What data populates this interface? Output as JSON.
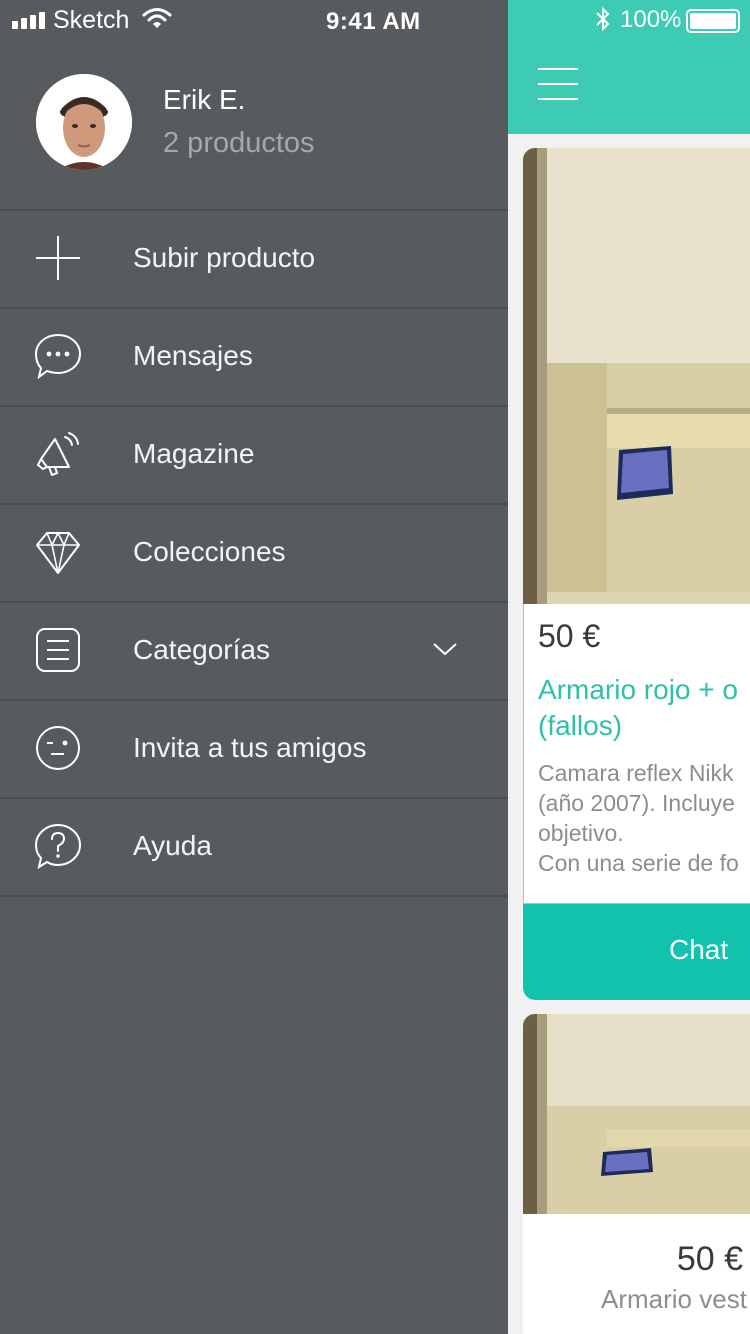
{
  "status_bar": {
    "carrier": "Sketch",
    "time": "9:41 AM",
    "battery_pct": "100%"
  },
  "profile": {
    "name": "Erik E.",
    "subtitle": "2 productos"
  },
  "menu": [
    {
      "label": "Subir producto",
      "icon": "plus-icon"
    },
    {
      "label": "Mensajes",
      "icon": "chat-bubble-icon"
    },
    {
      "label": "Magazine",
      "icon": "megaphone-icon"
    },
    {
      "label": "Colecciones",
      "icon": "diamond-icon"
    },
    {
      "label": "Categorías",
      "icon": "list-icon",
      "expandable": true
    },
    {
      "label": "Invita a tus amigos",
      "icon": "wink-face-icon"
    },
    {
      "label": "Ayuda",
      "icon": "help-icon"
    }
  ],
  "listing": {
    "price": "50 €",
    "title": "Armario rojo + o\n(fallos)",
    "description": "Camara reflex Nikk\n(año 2007). Incluye\nobjetivo.\nCon una serie de fo",
    "chat_label": "Chat"
  },
  "listing2": {
    "price": "50 €",
    "title": "Armario vest"
  },
  "colors": {
    "drawer_bg": "#575b5e",
    "accent": "#3ecbb4",
    "chat_button": "#11c3ac",
    "title_teal": "#2fc0a8"
  }
}
